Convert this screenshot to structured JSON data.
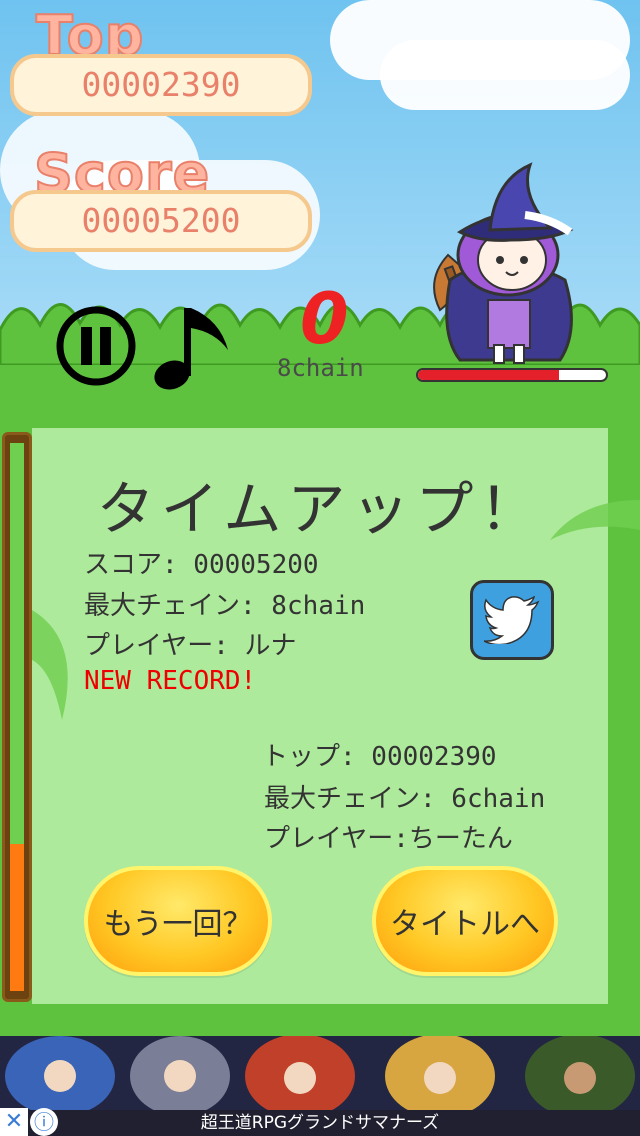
{
  "hud": {
    "top_label": "Top",
    "top_value": "00002390",
    "score_label": "Score",
    "score_value": "00005200",
    "chain_count": "0",
    "chain_label": "8chain",
    "hp_fraction": 0.75
  },
  "result": {
    "title": "タイムアップ！",
    "score_line": "スコア: 00005200",
    "max_chain_line": "最大チェイン: 8chain",
    "player_line": "プレイヤー: ルナ",
    "new_record": "NEW RECORD!",
    "top_line": "トップ: 00002390",
    "top_max_chain_line": "最大チェイン: 6chain",
    "top_player_line": "プレイヤー:ちーたん"
  },
  "buttons": {
    "retry": "もう一回？",
    "title": "タイトルへ"
  },
  "time_gauge_fraction": 0.27,
  "ad": {
    "caption": "超王道RPGグランドサマナーズ"
  },
  "icons": {
    "pause": "pause-icon",
    "music": "music-note-icon",
    "twitter": "twitter-bird-icon",
    "close": "close-icon",
    "info": "info-icon"
  },
  "colors": {
    "hp_fill": "#e4202a",
    "gauge_fill": "#ff7a10",
    "new_record": "#ee0000",
    "twitter": "#3fa0e0"
  }
}
